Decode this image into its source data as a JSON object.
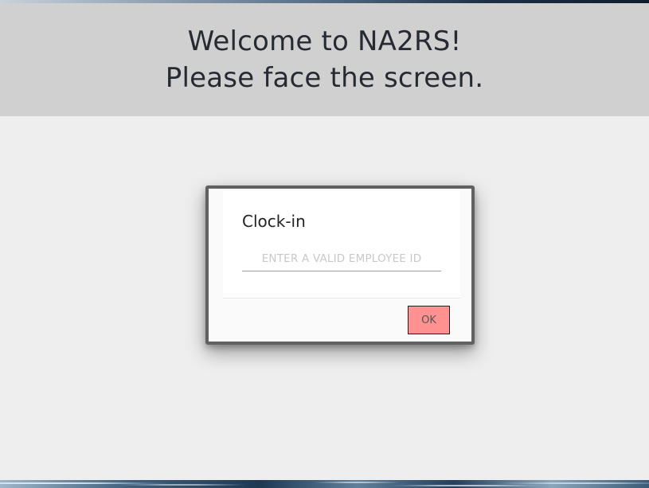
{
  "header": {
    "line1": "Welcome to NA2RS!",
    "line2": "Please face the screen."
  },
  "dialog": {
    "title": "Clock-in",
    "input": {
      "placeholder": "ENTER A VALID EMPLOYEE ID",
      "value": ""
    },
    "ok_label": "OK"
  },
  "colors": {
    "header_bg": "#d0d0d0",
    "page_bg": "#eeeeee",
    "dialog_border": "#616161",
    "ok_button_bg": "#ff9191"
  }
}
